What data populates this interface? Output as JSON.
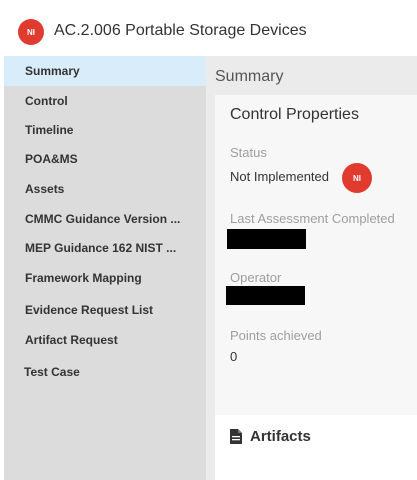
{
  "header": {
    "badge": "NI",
    "title": "AC.2.006 Portable Storage Devices"
  },
  "sidebar": {
    "items": [
      {
        "label": "Summary",
        "active": true
      },
      {
        "label": "Control"
      },
      {
        "label": "Timeline"
      },
      {
        "label": "POA&MS"
      },
      {
        "label": "Assets"
      },
      {
        "label": "CMMC Guidance Version ..."
      },
      {
        "label": "MEP Guidance 162 NIST ..."
      },
      {
        "label": "Framework Mapping"
      },
      {
        "label": "Evidence Request List"
      },
      {
        "label": "Artifact Request"
      },
      {
        "label": "Test Case"
      }
    ]
  },
  "main": {
    "section_title": "Summary",
    "card": {
      "title": "Control Properties",
      "status_label": "Status",
      "status_value": "Not Implemented",
      "status_badge": "NI",
      "last_assessment_label": "Last Assessment Completed",
      "operator_label": "Operator",
      "points_label": "Points achieved",
      "points_value": "0"
    },
    "artifacts": {
      "icon": "document-icon",
      "title": "Artifacts"
    }
  },
  "colors": {
    "badge": "#e03b2e",
    "sidebar_bg": "#dcdcdc",
    "active_item_bg": "#d9ecf9",
    "main_bg": "#ebebeb",
    "card_bg": "#f7f7f7"
  }
}
